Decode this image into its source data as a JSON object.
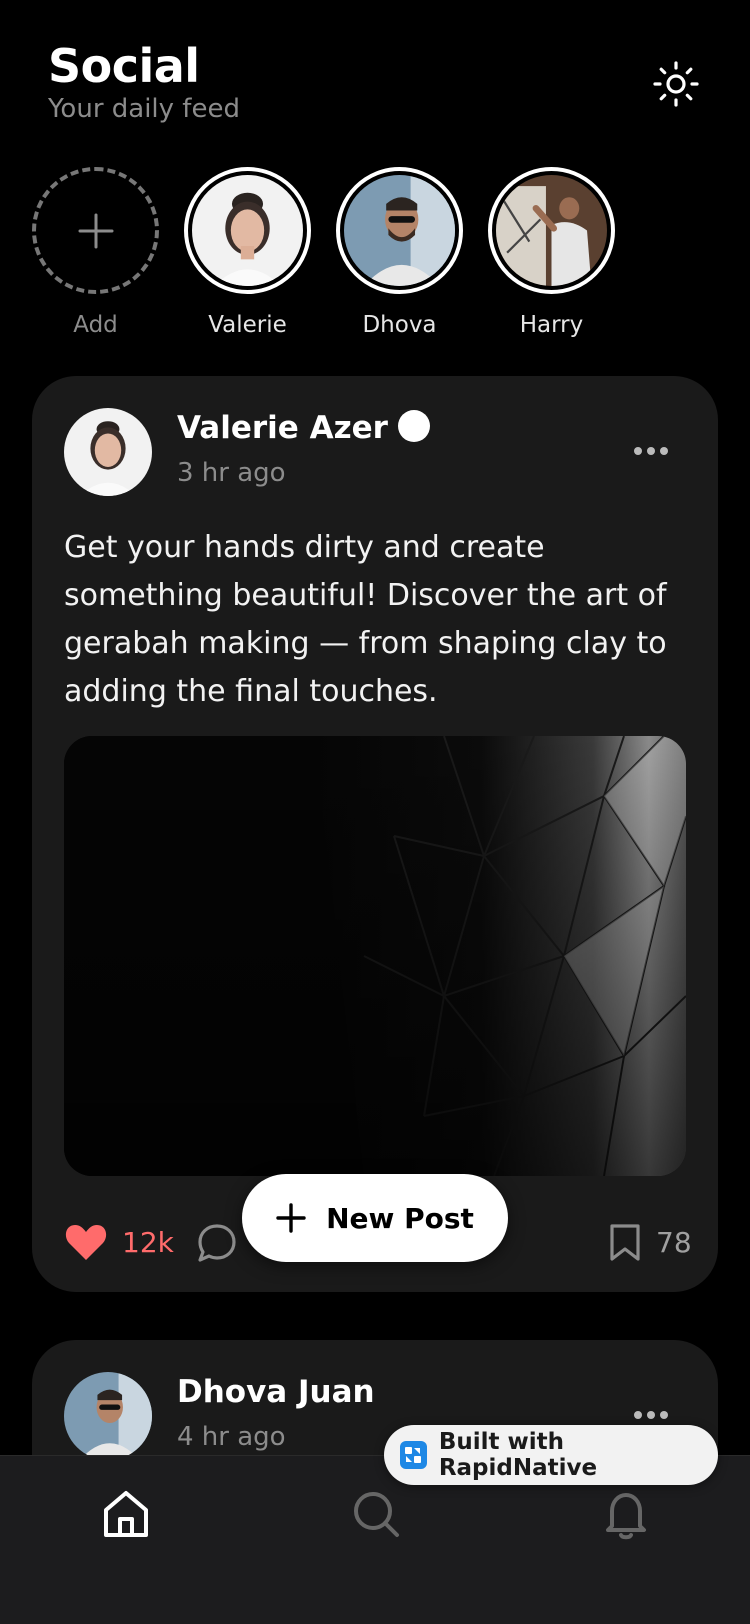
{
  "header": {
    "title": "Social",
    "subtitle": "Your daily feed",
    "theme_icon": "sun-icon"
  },
  "stories": {
    "add_label": "Add",
    "items": [
      {
        "name": "Valerie"
      },
      {
        "name": "Dhova"
      },
      {
        "name": "Harry"
      }
    ]
  },
  "posts": [
    {
      "author": "Valerie Azer",
      "time": "3 hr ago",
      "text": "Get your hands dirty and create something beautiful! Discover the art of gerabah making — from shaping clay to adding the final touches.",
      "likes": "12k",
      "bookmarks": "78"
    },
    {
      "author": "Dhova Juan",
      "time": "4 hr ago"
    }
  ],
  "fab": {
    "label": "New Post"
  },
  "badge": {
    "label": "Built with RapidNative"
  },
  "tabs": [
    {
      "icon": "home-icon"
    },
    {
      "icon": "search-icon"
    },
    {
      "icon": "bell-icon"
    }
  ],
  "colors": {
    "background": "#000000",
    "card": "#1a1a1a",
    "like": "#ff6b6b",
    "muted": "#8c8c8c"
  }
}
